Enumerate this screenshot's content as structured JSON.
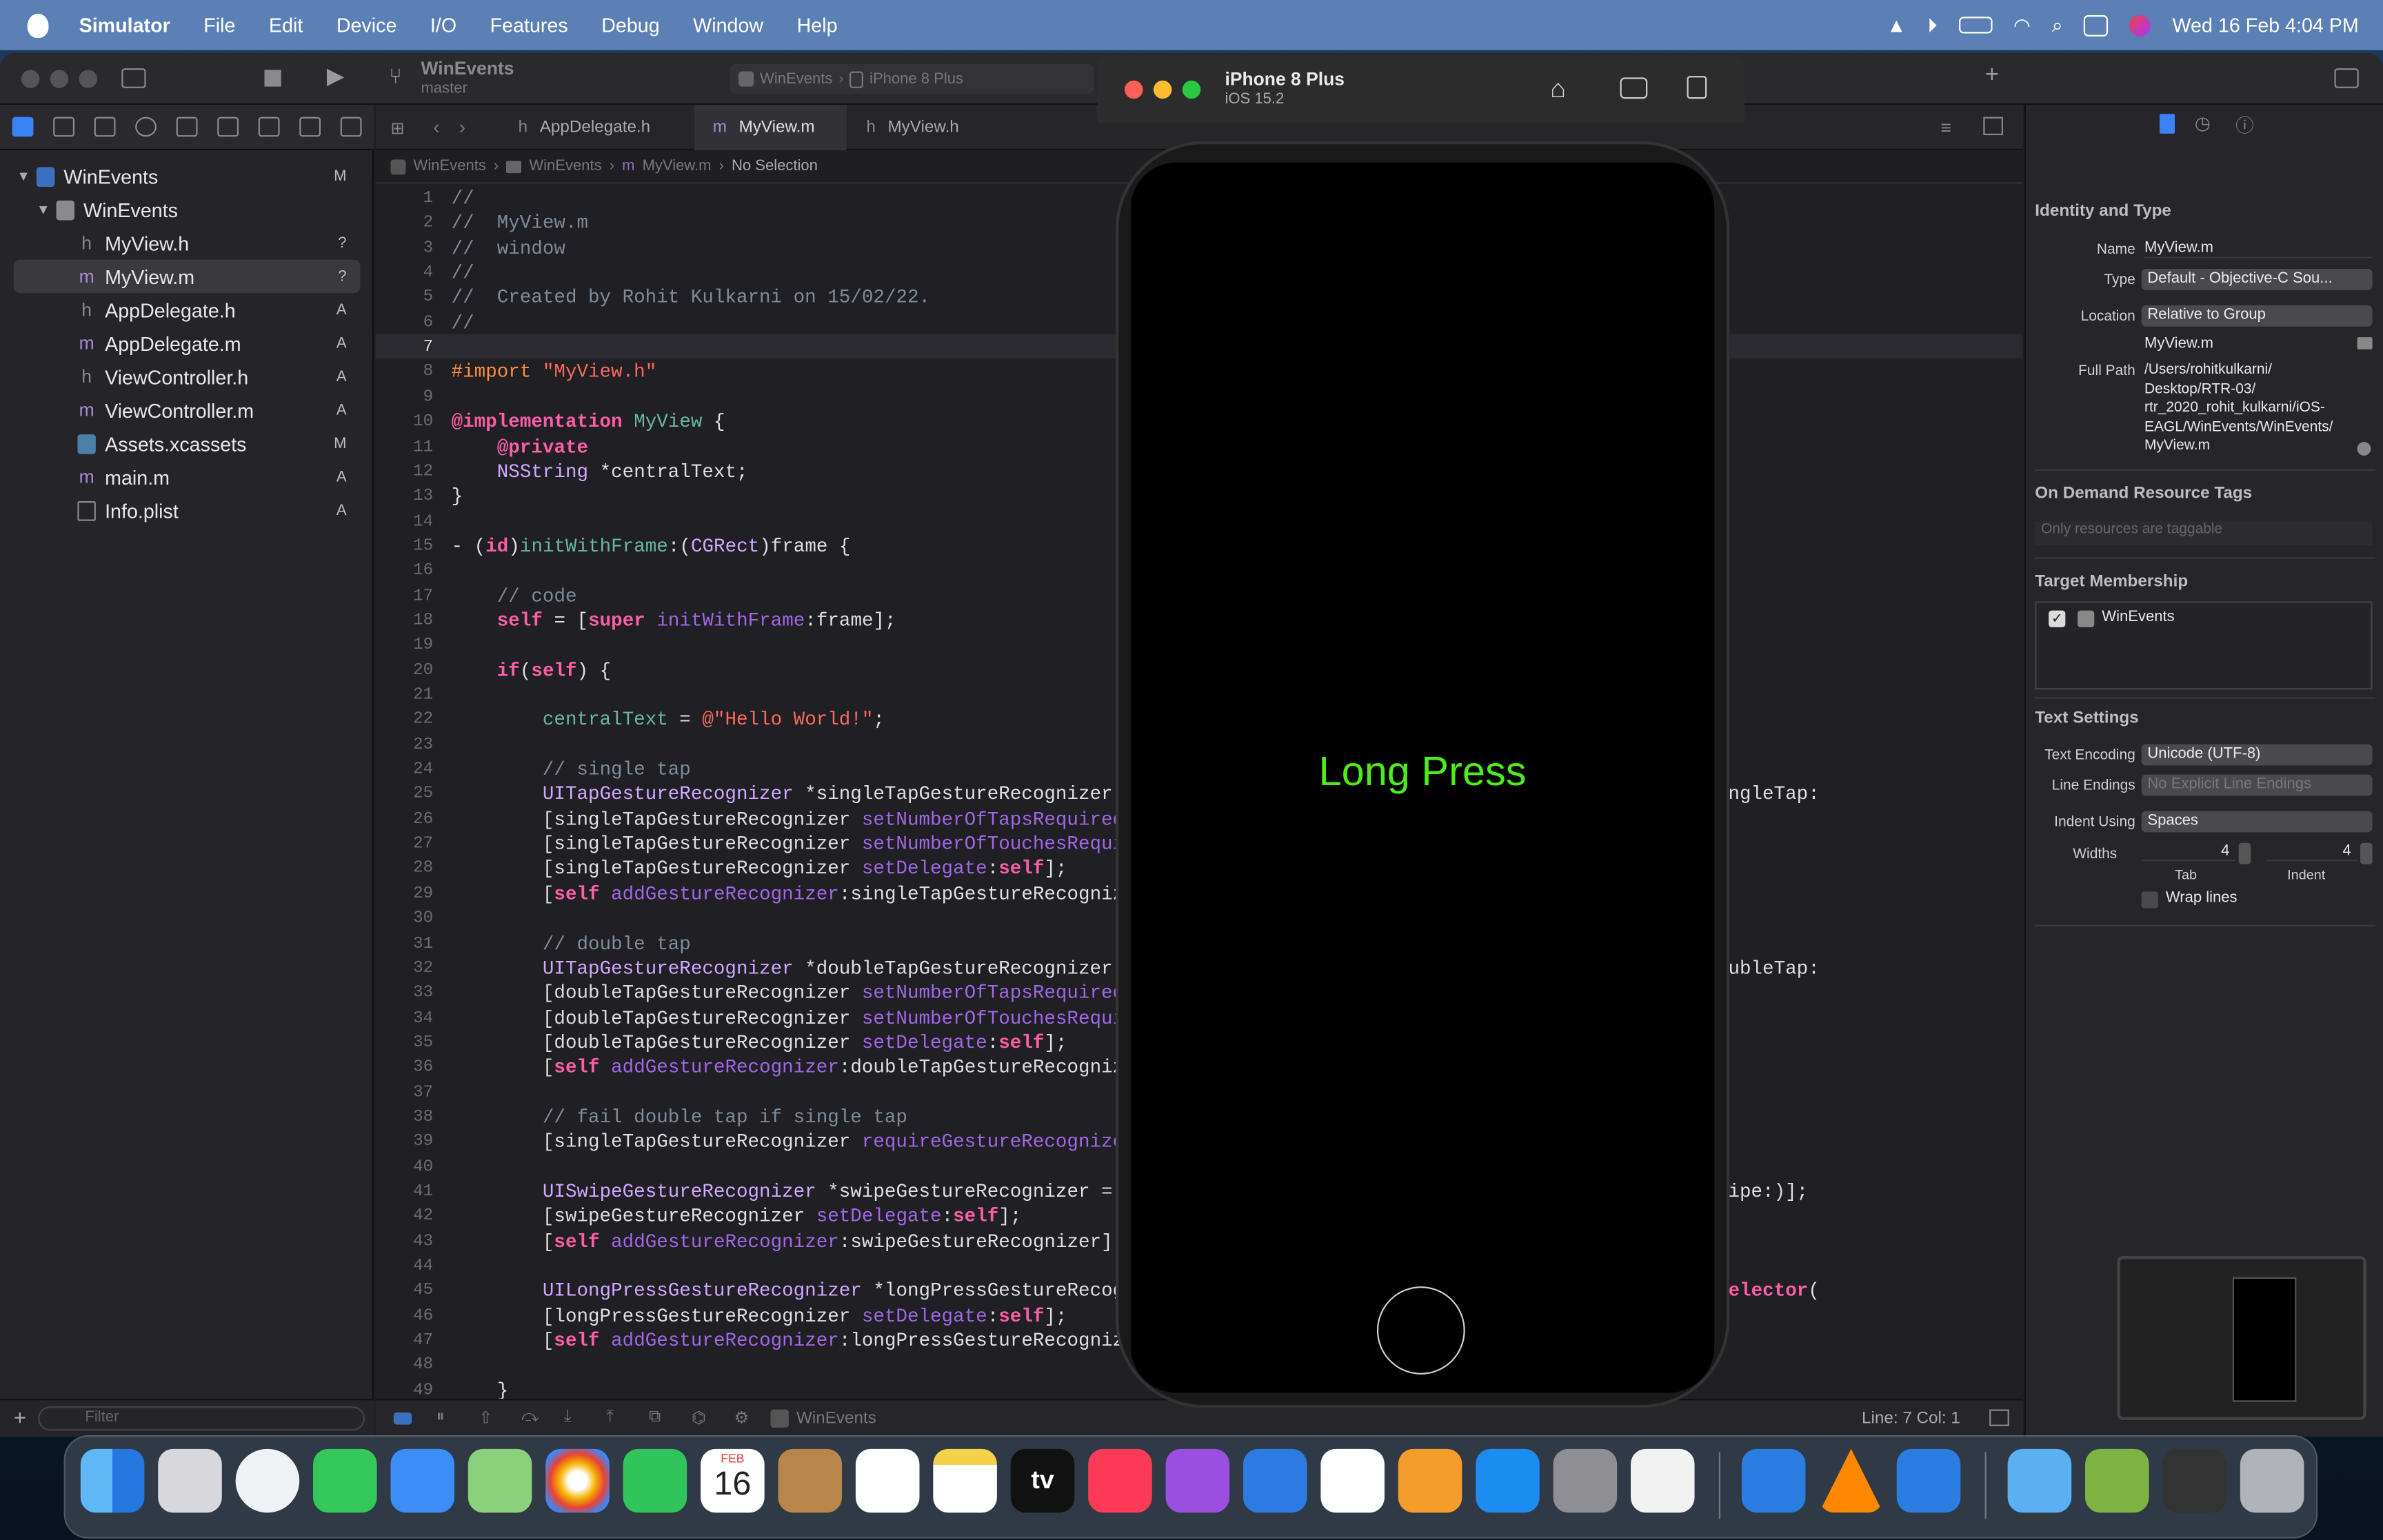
{
  "menubar": {
    "app": "Simulator",
    "items": [
      "File",
      "Edit",
      "Device",
      "I/O",
      "Features",
      "Debug",
      "Window",
      "Help"
    ],
    "clock": "Wed 16 Feb  4:04 PM"
  },
  "toolbar": {
    "project": "WinEvents",
    "branch": "master",
    "scheme": "WinEvents",
    "destination": "iPhone 8 Plus"
  },
  "navigator": {
    "items": [
      {
        "name": "WinEvents",
        "status": "M"
      },
      {
        "name": "WinEvents",
        "status": ""
      },
      {
        "name": "MyView.h",
        "status": "?"
      },
      {
        "name": "MyView.m",
        "status": "?"
      },
      {
        "name": "AppDelegate.h",
        "status": "A"
      },
      {
        "name": "AppDelegate.m",
        "status": "A"
      },
      {
        "name": "ViewController.h",
        "status": "A"
      },
      {
        "name": "ViewController.m",
        "status": "A"
      },
      {
        "name": "Assets.xcassets",
        "status": "M"
      },
      {
        "name": "main.m",
        "status": "A"
      },
      {
        "name": "Info.plist",
        "status": "A"
      }
    ],
    "filter_placeholder": "Filter"
  },
  "editor": {
    "tabs": [
      "AppDelegate.h",
      "MyView.m",
      "MyView.h"
    ],
    "jumpbar": [
      "WinEvents",
      "WinEvents",
      "MyView.m",
      "No Selection"
    ],
    "status": "Line: 7  Col: 1",
    "debug_target": "WinEvents"
  },
  "inspector": {
    "section_identity": "Identity and Type",
    "name_label": "Name",
    "name_value": "MyView.m",
    "type_label": "Type",
    "type_value": "Default - Objective-C Sou...",
    "location_label": "Location",
    "location_value": "Relative to Group",
    "location_file": "MyView.m",
    "fullpath_label": "Full Path",
    "fullpath_lines": [
      "/Users/rohitkulkarni/",
      "Desktop/RTR-03/",
      "rtr_2020_rohit_kulkarni/iOS-",
      "EAGL/WinEvents/WinEvents/",
      "MyView.m"
    ],
    "section_ondemand": "On Demand Resource Tags",
    "ondemand_placeholder": "Only resources are taggable",
    "section_target": "Target Membership",
    "target_item": "WinEvents",
    "section_text": "Text Settings",
    "encoding_label": "Text Encoding",
    "encoding_value": "Unicode (UTF-8)",
    "endings_label": "Line Endings",
    "endings_value": "No Explicit Line Endings",
    "indent_label": "Indent Using",
    "indent_value": "Spaces",
    "widths_label": "Widths",
    "tab_value": "4",
    "indent_value_num": "4",
    "tab_caption": "Tab",
    "indent_caption": "Indent",
    "wrap_label": "Wrap lines"
  },
  "simulator": {
    "device": "iPhone 8 Plus",
    "os": "iOS 15.2",
    "screen_text": "Long Press"
  },
  "dock": {
    "calendar_month": "FEB",
    "calendar_day": "16",
    "tv_label": "tv"
  },
  "colors": {
    "menubar": "#5a80b6",
    "screen_text": "#4ded1c",
    "editor_bg": "#1f1f24"
  }
}
